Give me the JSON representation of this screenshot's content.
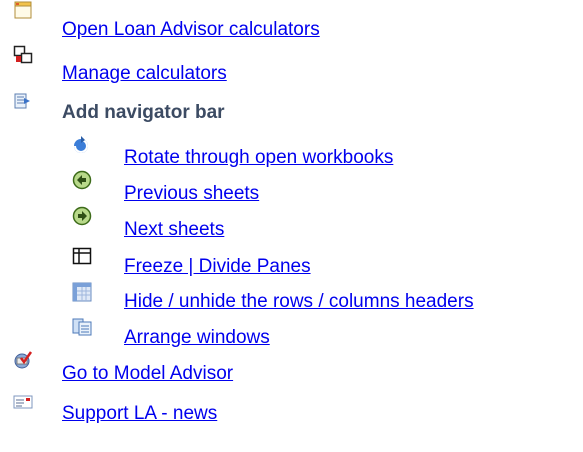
{
  "menu": {
    "open_calculators": {
      "label": "Open Loan Advisor calculators",
      "icon": "window-app-icon"
    },
    "manage_calculators": {
      "label": "Manage calculators",
      "icon": "manage-windows-icon"
    },
    "navigator_bar": {
      "label": "Add navigator bar",
      "icon": "navigator-bar-icon",
      "items": [
        {
          "label": "Rotate through open workbooks",
          "icon": "rotate-icon"
        },
        {
          "label": "Previous sheets",
          "icon": "previous-arrow-icon"
        },
        {
          "label": "Next sheets",
          "icon": "next-arrow-icon"
        },
        {
          "label": "Freeze | Divide Panes",
          "icon": "freeze-panes-icon"
        },
        {
          "label": "Hide / unhide the rows / columns headers",
          "icon": "headers-grid-icon"
        },
        {
          "label": "Arrange windows",
          "icon": "arrange-windows-icon"
        }
      ]
    },
    "model_advisor": {
      "label": "Go to Model Advisor",
      "icon": "model-advisor-icon"
    },
    "support_news": {
      "label": "Support LA - news",
      "icon": "envelope-icon"
    }
  }
}
